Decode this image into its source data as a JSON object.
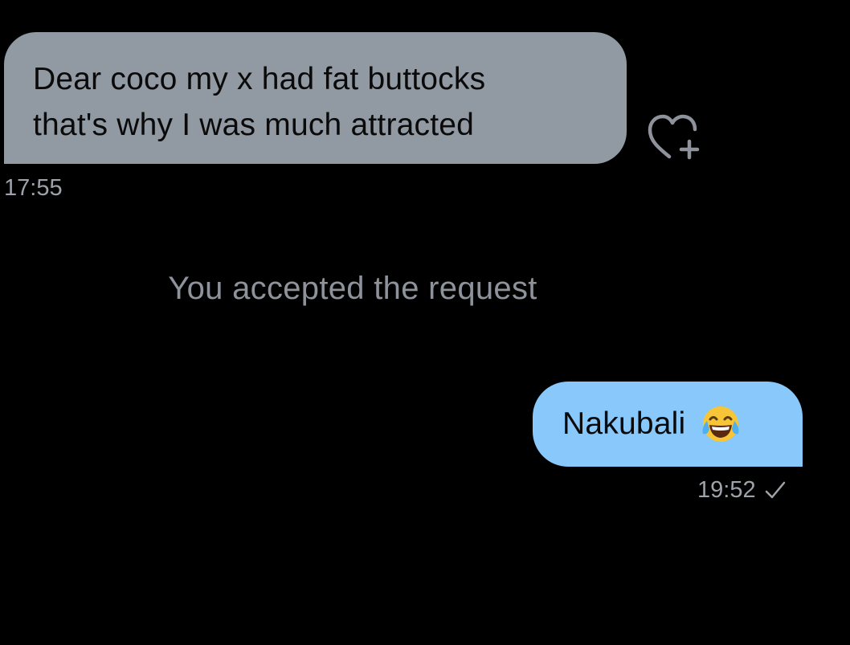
{
  "thread": {
    "received": {
      "lines": [
        "Dear coco my x had fat buttocks",
        "that's why I was much attracted"
      ],
      "time": "17:55",
      "bubble_color": "#9199a2"
    },
    "system_note": "You accepted the request",
    "sent": {
      "text": "Nakubali",
      "emoji": "face-with-tears-of-joy",
      "time": "19:52",
      "status_icon": "sent-check-icon",
      "bubble_color": "#88c8fb"
    },
    "reaction_icon": "heart-add-icon"
  }
}
